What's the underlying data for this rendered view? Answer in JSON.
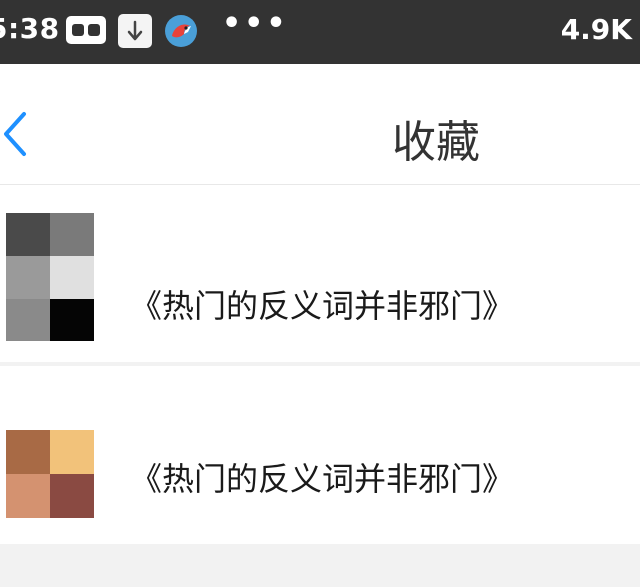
{
  "status_bar": {
    "time": "5:38",
    "net_speed": "4.9K",
    "more": "•••",
    "icons": [
      "cassette-icon",
      "download-icon",
      "bird-app-icon"
    ]
  },
  "nav": {
    "back_icon": "chevron-left-icon",
    "title": "收藏"
  },
  "favorites": [
    {
      "title": "《热门的反义词并非邪门》"
    },
    {
      "title": "《热门的反义词并非邪门》"
    }
  ],
  "colors": {
    "status_bar_bg": "#333333",
    "accent_blue": "#1e90ff",
    "page_bg": "#f2f2f2"
  }
}
